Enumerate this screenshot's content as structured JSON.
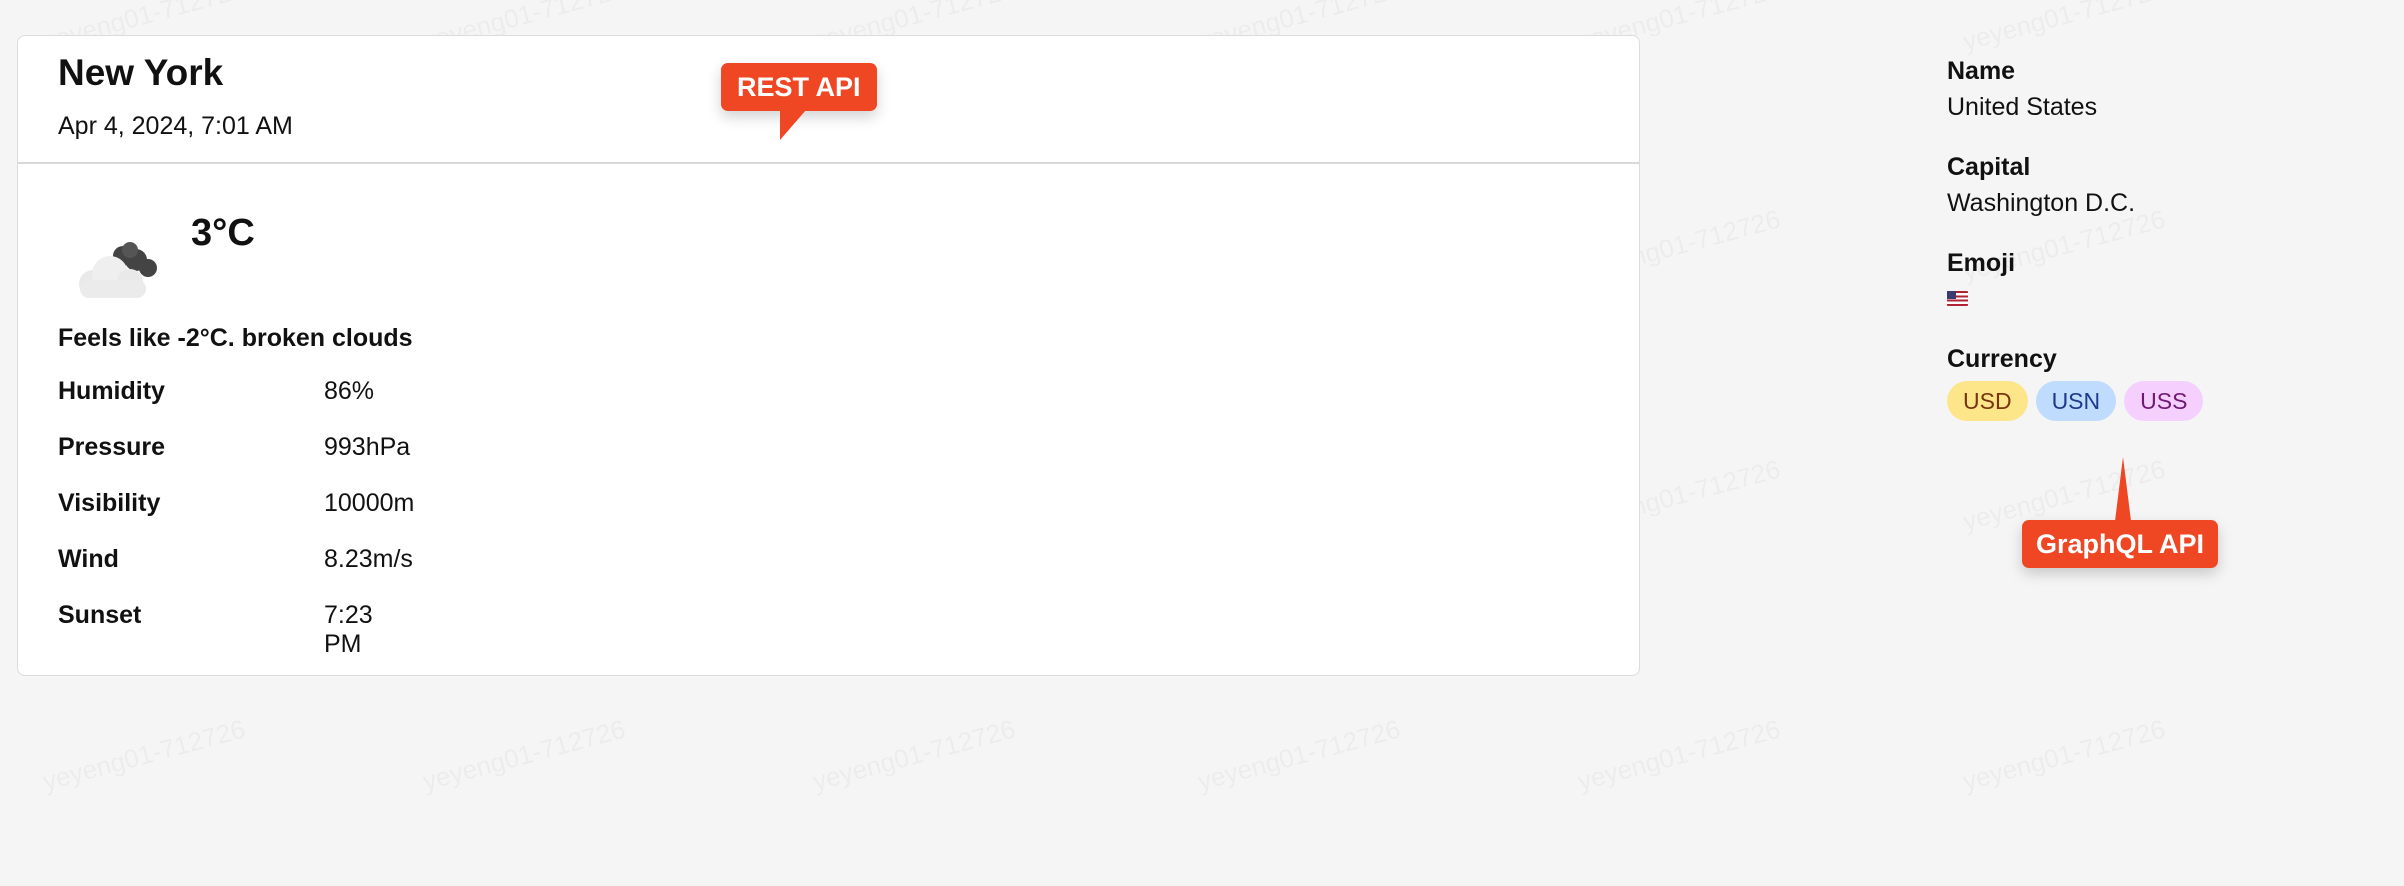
{
  "weather": {
    "city": "New York",
    "datetime": "Apr 4, 2024, 7:01 AM",
    "icon": "broken-clouds-icon",
    "temperature": "3°C",
    "feels_like": "Feels like -2°C. broken clouds",
    "stats": [
      {
        "label": "Humidity",
        "value": "86%"
      },
      {
        "label": "Pressure",
        "value": "993hPa"
      },
      {
        "label": "Visibility",
        "value": "10000m"
      },
      {
        "label": "Wind",
        "value": "8.23m/s"
      },
      {
        "label": "Sunset",
        "value": "7:23 PM"
      }
    ]
  },
  "country": {
    "name_label": "Name",
    "name_value": "United States",
    "capital_label": "Capital",
    "capital_value": "Washington D.C.",
    "emoji_label": "Emoji",
    "emoji_icon": "us-flag-icon",
    "currency_label": "Currency",
    "currencies": [
      {
        "code": "USD",
        "bg": "#fde68a",
        "color": "#78350f"
      },
      {
        "code": "USN",
        "bg": "#bfdbfe",
        "color": "#1e3a8a"
      },
      {
        "code": "USS",
        "bg": "#f5d0fe",
        "color": "#701a75"
      }
    ]
  },
  "callouts": {
    "rest": "REST API",
    "graphql": "GraphQL API",
    "color": "#ef4623"
  },
  "watermark_text": "yeyeng01-712726"
}
